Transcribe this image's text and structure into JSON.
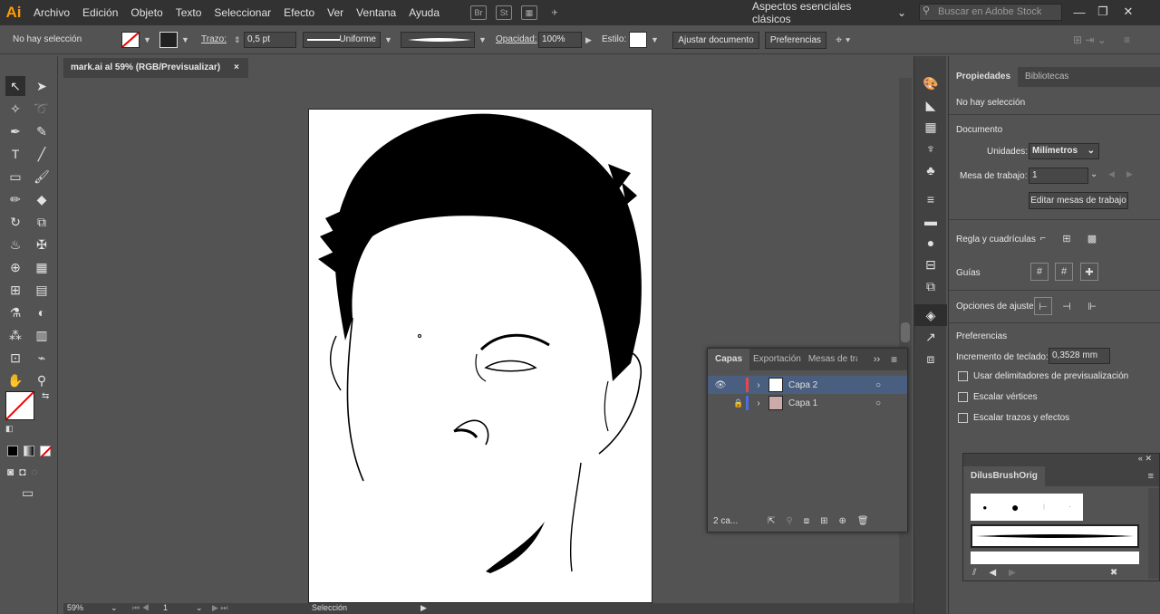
{
  "app": {
    "logo": "Ai",
    "workspace": "Aspectos esenciales clásicos",
    "search_placeholder": "Buscar en Adobe Stock"
  },
  "menu": [
    "Archivo",
    "Edición",
    "Objeto",
    "Texto",
    "Seleccionar",
    "Efecto",
    "Ver",
    "Ventana",
    "Ayuda"
  ],
  "menu_icons": [
    "Br",
    "St"
  ],
  "control": {
    "selection": "No hay selección",
    "stroke_label": "Trazo:",
    "stroke_value": "0,5 pt",
    "profile": "Uniforme",
    "opacity_label": "Opacidad:",
    "opacity_value": "100%",
    "style_label": "Estilo:",
    "doc_setup": "Ajustar documento",
    "prefs": "Preferencias"
  },
  "document": {
    "tab_title": "mark.ai al 59% (RGB/Previsualizar)",
    "close": "×"
  },
  "properties": {
    "tabs": [
      "Propiedades",
      "Bibliotecas"
    ],
    "no_selection": "No hay selección",
    "doc_title": "Documento",
    "units_label": "Unidades:",
    "units_value": "Milímetros",
    "artboard_label": "Mesa de trabajo:",
    "artboard_value": "1",
    "edit_artboards": "Editar mesas de trabajo",
    "rulers_label": "Regla y cuadrículas",
    "guides_label": "Guías",
    "snap_label": "Opciones de ajuste",
    "prefs_title": "Preferencias",
    "keyboard_label": "Incremento de teclado:",
    "keyboard_value": "0,3528 mm",
    "checks": [
      "Usar delimitadores de previsualización",
      "Escalar vértices",
      "Escalar trazos y efectos"
    ]
  },
  "layers": {
    "tabs": [
      "Capas",
      "Exportación",
      "Mesas de tra"
    ],
    "items": [
      {
        "name": "Capa 2",
        "color": "#e04a4a"
      },
      {
        "name": "Capa 1",
        "color": "#4a6ee0"
      }
    ],
    "footer": "2 ca..."
  },
  "brushes": {
    "tab": "DilusBrushOrig"
  },
  "status": {
    "zoom": "59%",
    "page": "1",
    "tool": "Selección"
  },
  "colors": {
    "selected_row": "#4a5f80"
  }
}
